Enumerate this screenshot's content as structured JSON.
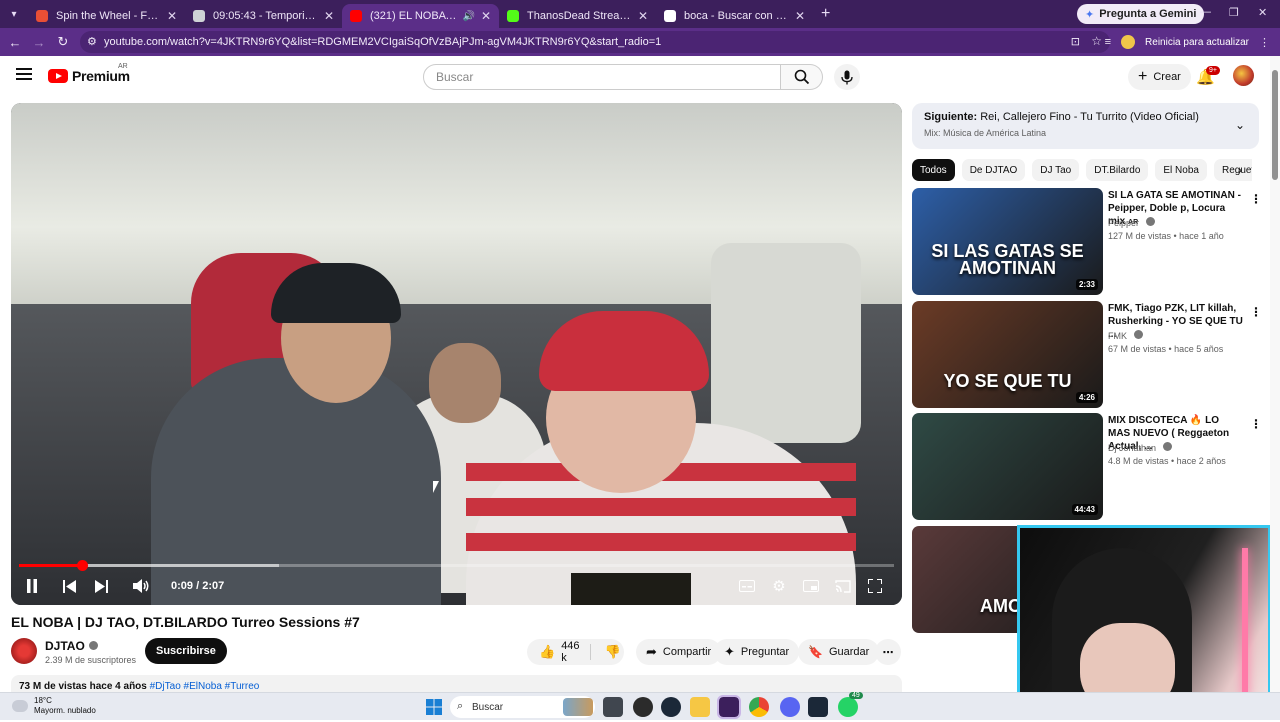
{
  "browser": {
    "tabs": [
      {
        "title": "Spin the Wheel - Free Wheel Spinner",
        "color": "#e94f35",
        "active": false
      },
      {
        "title": "09:05:43 - Temporizador Online",
        "color": "#cfd2d6",
        "active": false
      },
      {
        "title": "(321) EL NOBA | DJ TAO, DT.BILARDO",
        "color": "#ff0000",
        "active": true
      },
      {
        "title": "ThanosDead Stream - Watch Live",
        "color": "#53fc18",
        "active": false
      },
      {
        "title": "boca - Buscar con Google",
        "color": "#ffffff",
        "active": false
      }
    ],
    "new_tab": "+",
    "gemini_label": "Pregunta a Gemini",
    "url": "youtube.com/watch?v=4JKTRN9r6YQ&list=RDGMEM2VCIgaiSqOfVzBAjPJm-agVM4JKTRN9r6YQ&start_radio=1",
    "restart_label": "Reinicia para actualizar"
  },
  "youtube": {
    "logo_text": "Premium",
    "country_code": "AR",
    "search_placeholder": "Buscar",
    "create_label": "Crear",
    "notifications_badge": "9+"
  },
  "player": {
    "time_current": "0:09",
    "time_total": "2:07",
    "progress": 0.072
  },
  "video": {
    "title": "EL NOBA | DJ TAO, DT.BILARDO Turreo Sessions #7",
    "channel": "DJTAO",
    "subscribers": "2.39 M de suscriptores",
    "subscribe_label": "Suscribirse",
    "likes": "446 k",
    "share_label": "Compartir",
    "ask_label": "Preguntar",
    "save_label": "Guardar",
    "description_meta": "73 M de vistas  hace 4 años",
    "description_tags": "#DjTao #ElNoba #Turreo"
  },
  "sidebar": {
    "next_prefix": "Siguiente:",
    "next_title": "Rei, Callejero Fino - Tu Turrito (Video Oficial)",
    "next_mix": "Mix: Música de América Latina",
    "chips": [
      "Todos",
      "De DJTAO",
      "DJ Tao",
      "DT.Bilardo",
      "El Noba",
      "Reguetón"
    ],
    "recommendations": [
      {
        "title": "SI LA GATA SE AMOTINAN - Peipper, Doble p, Locura mix",
        "tag": "AR",
        "channel": "Peipper",
        "meta": "127 M de vistas • hace 1 año",
        "duration": "2:33",
        "thumb_text": "SI LAS GATAS SE AMOTINAN",
        "thumb_color": "#2d5fa8"
      },
      {
        "title": "FMK, Tiago PZK, LIT killah, Rusherking - YO SE QUE TU ...",
        "tag": "",
        "channel": "FMK",
        "meta": "67 M de vistas • hace 5 años",
        "duration": "4:26",
        "thumb_text": "YO SE QUE TU",
        "thumb_color": "#6b3b26"
      },
      {
        "title": "MIX DISCOTECA 🔥 LO MAS NUEVO ( Reggaeton Actual, ...",
        "tag": "",
        "channel": "Dj Jonathan",
        "meta": "4.8 M de vistas • hace 2 años",
        "duration": "44:43",
        "thumb_text": "",
        "thumb_color": "#2f4a45"
      },
      {
        "title": "",
        "tag": "",
        "channel": "",
        "meta": "",
        "duration": "",
        "thumb_text": "AMOR",
        "thumb_color": "#5a3a3a"
      }
    ]
  },
  "taskbar": {
    "temperature": "18°C",
    "weather": "Mayorm. nublado",
    "search_label": "Buscar",
    "whatsapp_badge": "49"
  }
}
